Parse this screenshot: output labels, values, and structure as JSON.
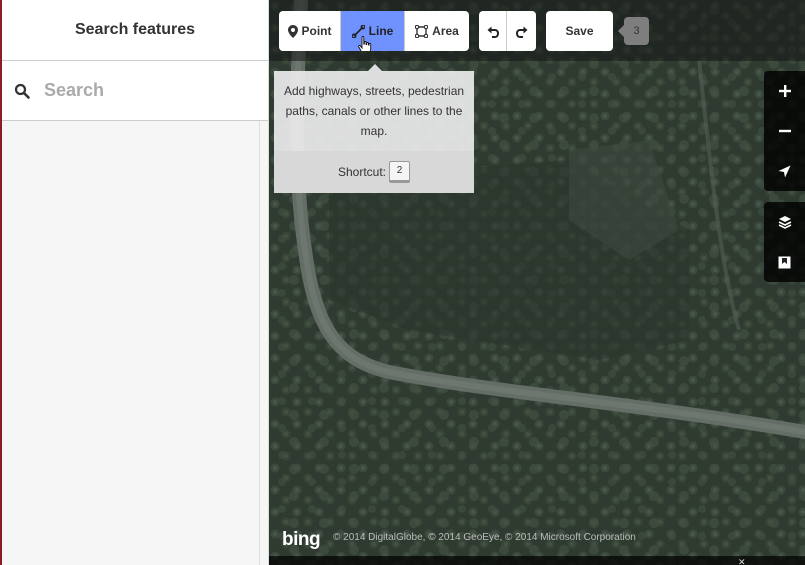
{
  "sidebar": {
    "title": "Search features",
    "search": {
      "placeholder": "Search",
      "value": ""
    }
  },
  "toolbar": {
    "modes": [
      {
        "label": "Point",
        "icon": "map-marker-icon",
        "active": false
      },
      {
        "label": "Line",
        "icon": "line-icon",
        "active": true
      },
      {
        "label": "Area",
        "icon": "area-icon",
        "active": false
      }
    ],
    "undo_icon": "undo-icon",
    "redo_icon": "redo-icon",
    "save_label": "Save",
    "edit_count": "3"
  },
  "tooltip": {
    "text": "Add highways, streets, pedestrian paths, canals or other lines to the map.",
    "shortcut_label": "Shortcut:",
    "shortcut_key": "2"
  },
  "map_controls": {
    "zoom_in": "plus-icon",
    "zoom_out": "minus-icon",
    "geolocate": "location-arrow-icon",
    "background": "layers-icon",
    "map_data": "map-data-icon"
  },
  "attribution": {
    "logo": "bing",
    "text": "© 2014 DigitalGlobe, © 2014 GeoEye, © 2014 Microsoft Corporation"
  },
  "colors": {
    "active_mode": "#7092ff",
    "sidebar_edge": "#8a1c2a"
  }
}
